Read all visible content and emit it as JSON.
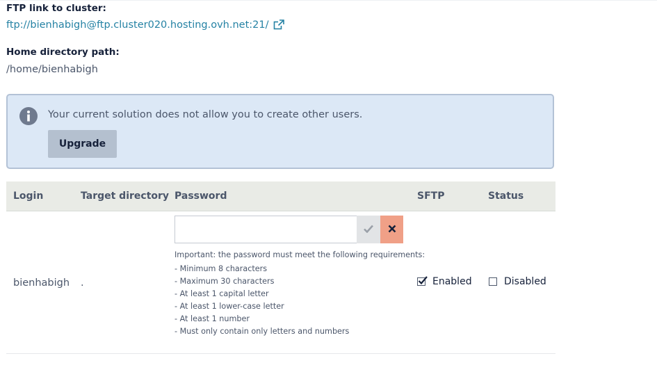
{
  "ftp": {
    "label": "FTP link to cluster:",
    "link": "ftp://bienhabigh@ftp.cluster020.hosting.ovh.net:21/",
    "link_icon": "external-link-icon"
  },
  "home": {
    "label": "Home directory path:",
    "path": "/home/bienhabigh"
  },
  "notice": {
    "icon": "info-icon",
    "text": "Your current solution does not allow you to create other users.",
    "button_label": "Upgrade"
  },
  "table": {
    "columns": [
      "Login",
      "Target directory",
      "Password",
      "SFTP",
      "Status"
    ],
    "row": {
      "login": "bienhabigh",
      "target_directory": ".",
      "password_value": "",
      "validate_icon": "check-icon",
      "cancel_icon": "close-icon",
      "requirements_title": "Important: the password must meet the following requirements:",
      "requirements": [
        "- Minimum 8 characters",
        "- Maximum 30 characters",
        "- At least 1 capital letter",
        "- At least 1 lower-case letter",
        "- At least 1 number",
        "- Must only contain only letters and numbers"
      ],
      "enabled_label": "Enabled",
      "enabled_checked": true,
      "disabled_label": "Disabled",
      "disabled_checked": false
    }
  },
  "colors": {
    "link": "#2582a4",
    "notice_bg": "#dce8f6",
    "button_bg": "#b4c0cf",
    "cancel_bg": "#f0a087",
    "header_bg": "#e9ebe6"
  }
}
